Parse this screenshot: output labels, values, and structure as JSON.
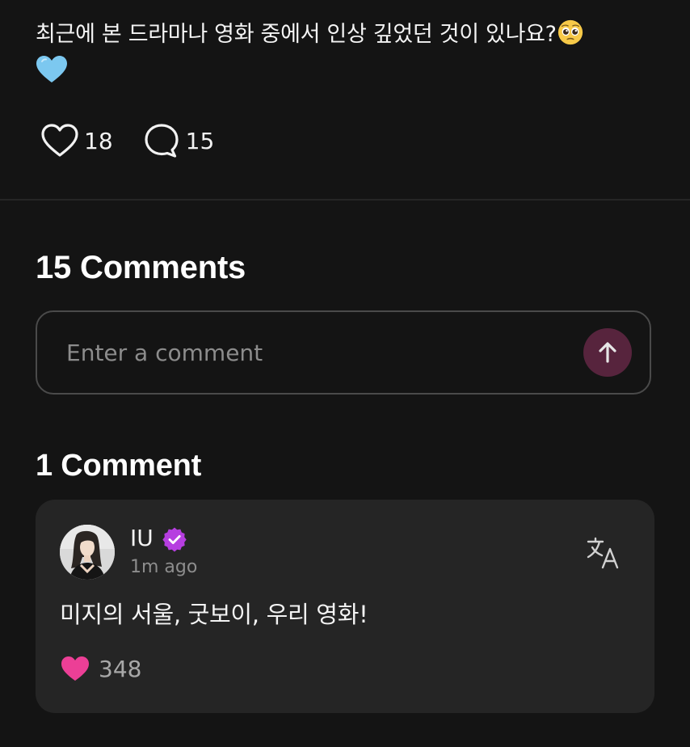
{
  "post": {
    "text": "최근에 본 드라마나 영화 중에서 인상 깊었던 것이 있나요?",
    "emoji_1": "pleading-face-emoji",
    "emoji_2": "light-blue-heart-emoji",
    "likes": "18",
    "comments": "15"
  },
  "comments_section": {
    "title": "15 Comments",
    "input_placeholder": "Enter a comment",
    "sub_title": "1 Comment"
  },
  "comment": {
    "author": "IU",
    "time": "1m ago",
    "body": "미지의 서울, 굿보이, 우리 영화!",
    "likes": "348"
  },
  "colors": {
    "background": "#141414",
    "card": "#252525",
    "accent_pink": "#ec3f96",
    "send_button": "#57243d",
    "verified": "#b63ee0"
  },
  "icons": {
    "like": "heart-outline-icon",
    "comment": "speech-bubble-icon",
    "send": "arrow-up-icon",
    "verified": "verified-badge-icon",
    "translate": "translate-icon",
    "comment_like": "heart-filled-icon"
  }
}
